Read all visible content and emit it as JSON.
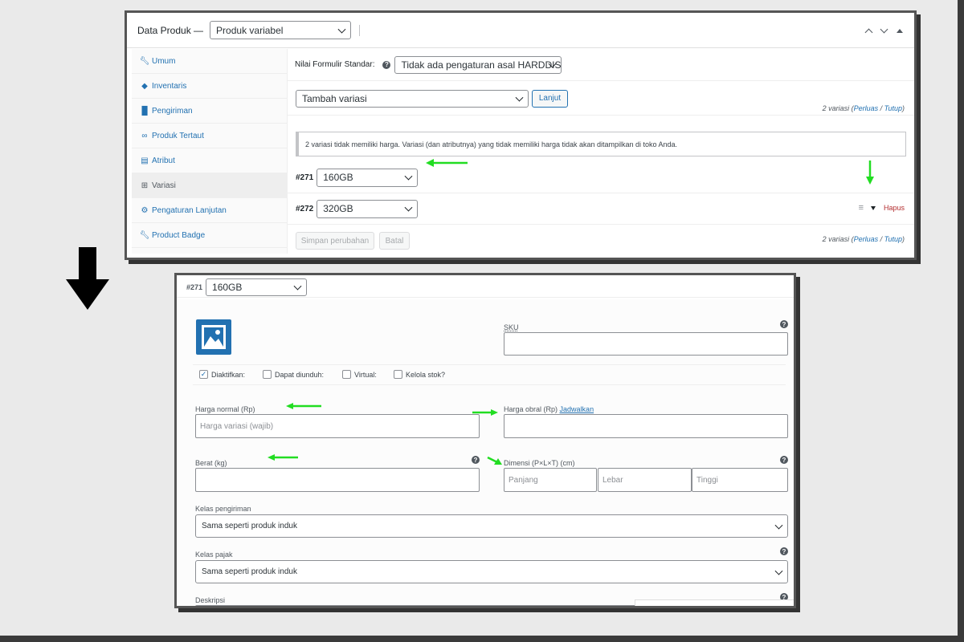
{
  "top": {
    "header": {
      "title": "Data Produk —",
      "product_type": "Produk variabel"
    },
    "tabs": [
      {
        "label": "Umum",
        "icon": "wrench-icon"
      },
      {
        "label": "Inventaris",
        "icon": "tag-icon"
      },
      {
        "label": "Pengiriman",
        "icon": "truck-icon"
      },
      {
        "label": "Produk Tertaut",
        "icon": "link-icon"
      },
      {
        "label": "Atribut",
        "icon": "list-icon"
      },
      {
        "label": "Variasi",
        "icon": "grid-icon"
      },
      {
        "label": "Pengaturan Lanjutan",
        "icon": "gear-icon"
      },
      {
        "label": "Product Badge",
        "icon": "wrench-icon"
      }
    ],
    "default_form": {
      "label": "Nilai Formulir Standar:",
      "value": "Tidak ada pengaturan asal HARDDISK..."
    },
    "add_variation": {
      "value": "Tambah variasi",
      "button": "Lanjut"
    },
    "count_meta": {
      "count": "2 variasi (",
      "expand": "Perluas",
      "sep": " / ",
      "close": "Tutup",
      "end": ")"
    },
    "notice": "2 variasi tidak memiliki harga. Variasi (dan atributnya) yang tidak memiliki harga tidak akan ditampilkan di toko Anda.",
    "variations": [
      {
        "id": "#271",
        "value": "160GB"
      },
      {
        "id": "#272",
        "value": "320GB"
      }
    ],
    "remove": "Hapus",
    "save_button": "Simpan perubahan",
    "cancel_button": "Batal"
  },
  "bottom": {
    "variation": {
      "id": "#271",
      "value": "160GB"
    },
    "sku_label": "SKU",
    "checkboxes": [
      {
        "label": "Diaktifkan:",
        "checked": true
      },
      {
        "label": "Dapat diunduh:",
        "checked": false
      },
      {
        "label": "Virtual:",
        "checked": false
      },
      {
        "label": "Kelola stok?",
        "checked": false
      }
    ],
    "regular_price_label": "Harga normal (Rp)",
    "regular_price_placeholder": "Harga variasi (wajib)",
    "sale_price_label": "Harga obral (Rp)",
    "schedule_link": "Jadwalkan",
    "weight_label": "Berat (kg)",
    "dimensions_label": "Dimensi (P×L×T) (cm)",
    "length_placeholder": "Panjang",
    "width_placeholder": "Lebar",
    "height_placeholder": "Tinggi",
    "shipping_class_label": "Kelas pengiriman",
    "shipping_class_value": "Sama seperti produk induk",
    "tax_class_label": "Kelas pajak",
    "tax_class_value": "Sama seperti produk induk",
    "description_label": "Deskripsi"
  },
  "colors": {
    "arrow_green": "#22dd22",
    "link_blue": "#2271b1",
    "delete_red": "#b32d2e"
  }
}
